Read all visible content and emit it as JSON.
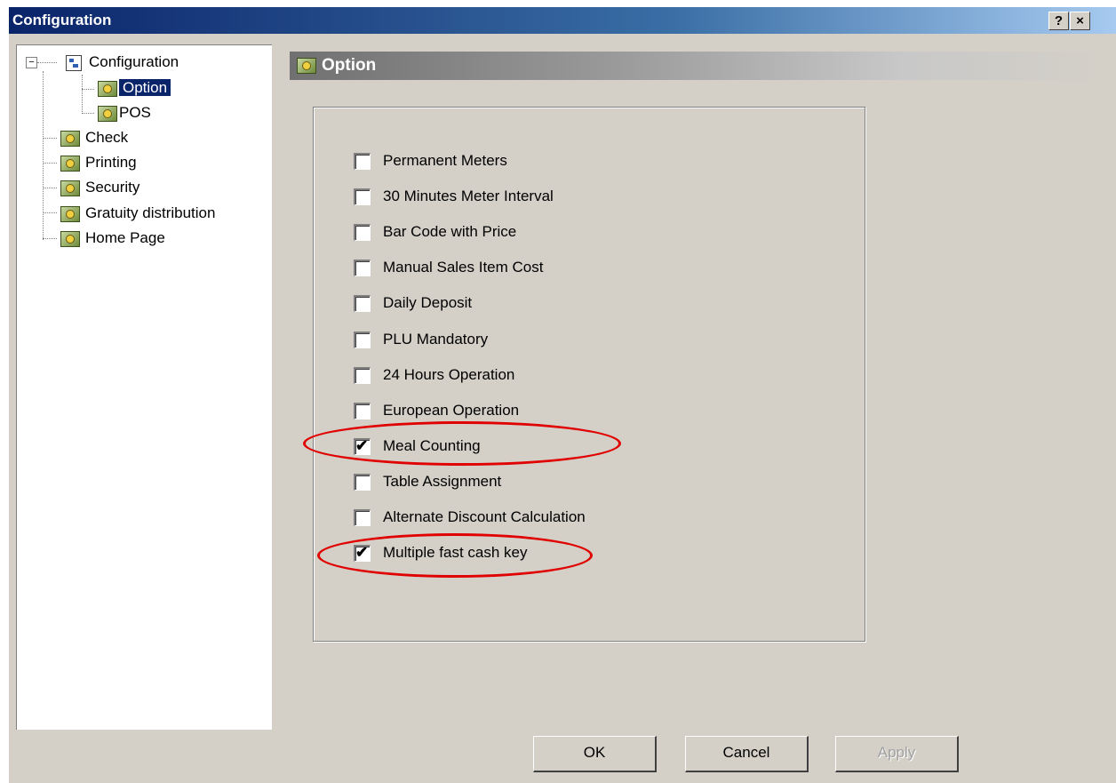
{
  "window": {
    "title": "Configuration",
    "help_button": "?",
    "close_button": "×"
  },
  "tree": {
    "root": "Configuration",
    "items": [
      {
        "label": "Option",
        "selected": true
      },
      {
        "label": "POS"
      },
      {
        "label": "Check"
      },
      {
        "label": "Printing"
      },
      {
        "label": "Security"
      },
      {
        "label": "Gratuity distribution"
      },
      {
        "label": "Home Page"
      }
    ]
  },
  "section": {
    "title": "Option"
  },
  "options": [
    {
      "label": "Permanent Meters",
      "checked": false
    },
    {
      "label": "30 Minutes Meter Interval",
      "checked": false
    },
    {
      "label": "Bar Code with Price",
      "checked": false
    },
    {
      "label": "Manual Sales Item Cost",
      "checked": false
    },
    {
      "label": "Daily Deposit",
      "checked": false
    },
    {
      "label": "PLU Mandatory",
      "checked": false
    },
    {
      "label": "24 Hours Operation",
      "checked": false
    },
    {
      "label": "European Operation",
      "checked": false
    },
    {
      "label": "Meal Counting",
      "checked": true,
      "highlighted": true
    },
    {
      "label": "Table Assignment",
      "checked": false
    },
    {
      "label": "Alternate Discount Calculation",
      "checked": false
    },
    {
      "label": "Multiple fast cash key",
      "checked": true,
      "highlighted": true
    }
  ],
  "buttons": {
    "ok": "OK",
    "cancel": "Cancel",
    "apply": "Apply"
  },
  "colors": {
    "highlight_ellipse": "#e00000",
    "selection": "#0a246a"
  }
}
